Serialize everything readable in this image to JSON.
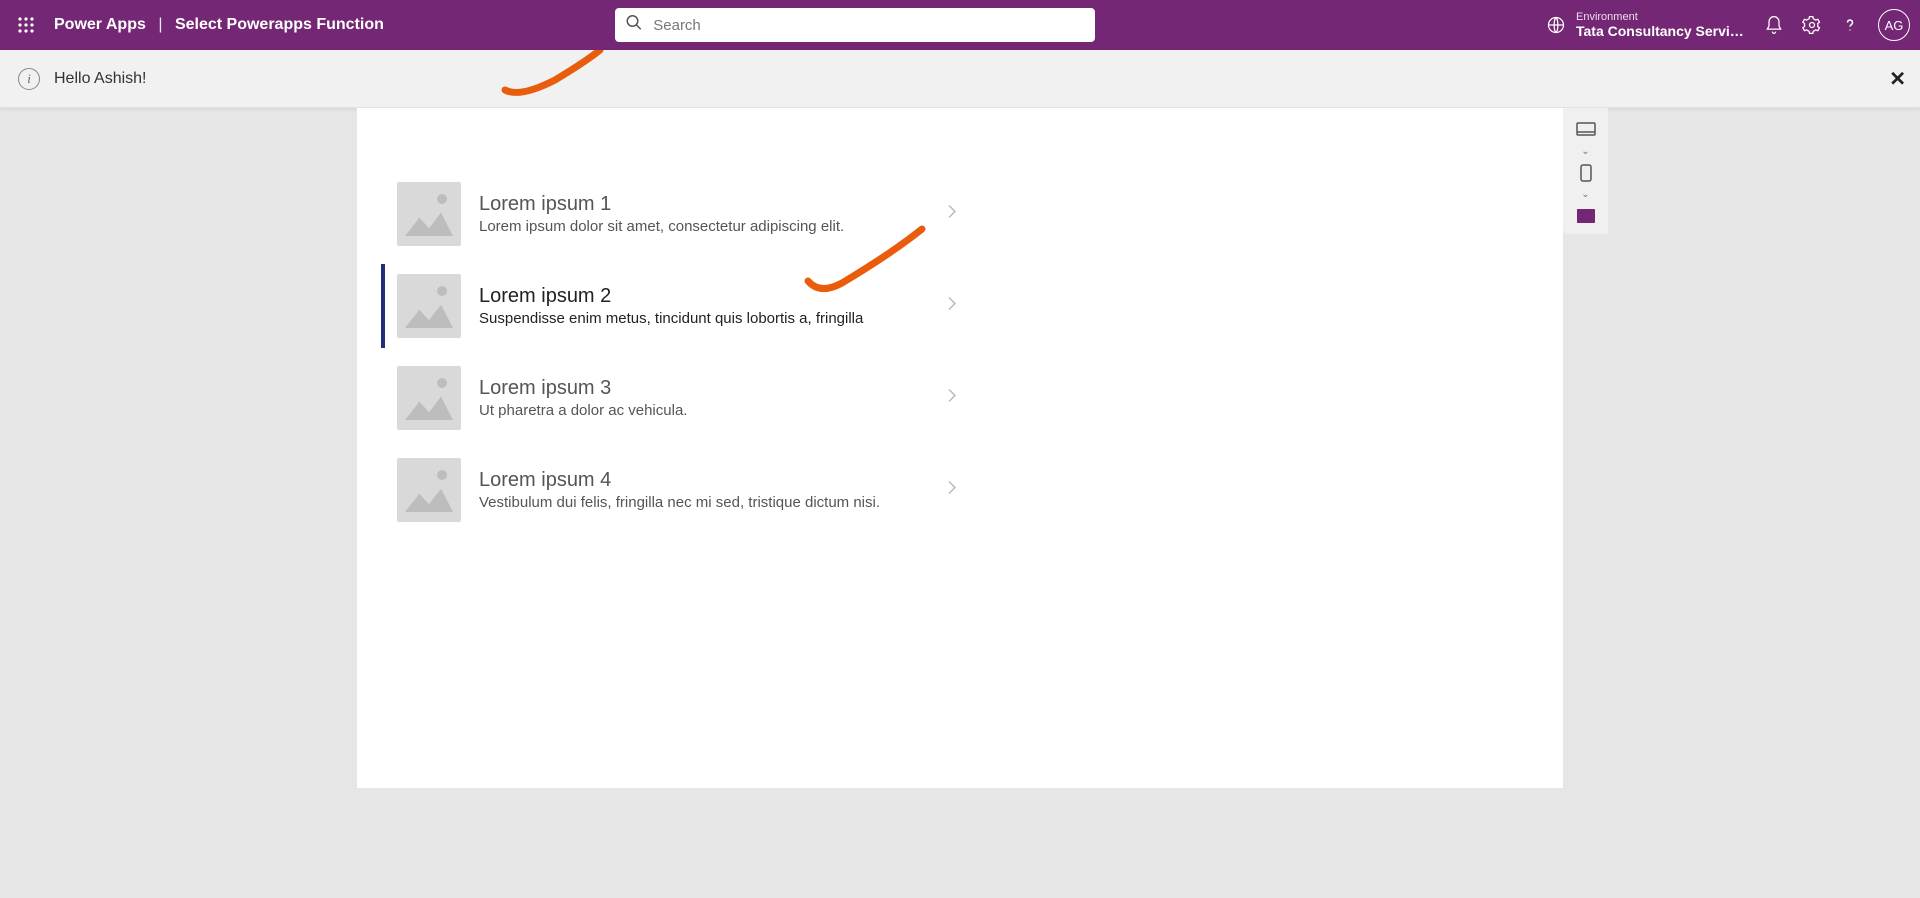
{
  "header": {
    "brand": "Power Apps",
    "page_title": "Select Powerapps Function",
    "search_placeholder": "Search",
    "env_label": "Environment",
    "env_name": "Tata Consultancy Servic…",
    "avatar_initials": "AG"
  },
  "banner": {
    "message": "Hello Ashish!"
  },
  "gallery": [
    {
      "title": "Lorem ipsum 1",
      "subtitle": "Lorem ipsum dolor sit amet, consectetur adipiscing elit.",
      "selected": false
    },
    {
      "title": "Lorem ipsum 2",
      "subtitle": "Suspendisse enim metus, tincidunt quis lobortis a, fringilla",
      "selected": true
    },
    {
      "title": "Lorem ipsum 3",
      "subtitle": "Ut pharetra a dolor ac vehicula.",
      "selected": false
    },
    {
      "title": "Lorem ipsum 4",
      "subtitle": "Vestibulum dui felis, fringilla nec mi sed, tristique dictum nisi.",
      "selected": false
    }
  ]
}
